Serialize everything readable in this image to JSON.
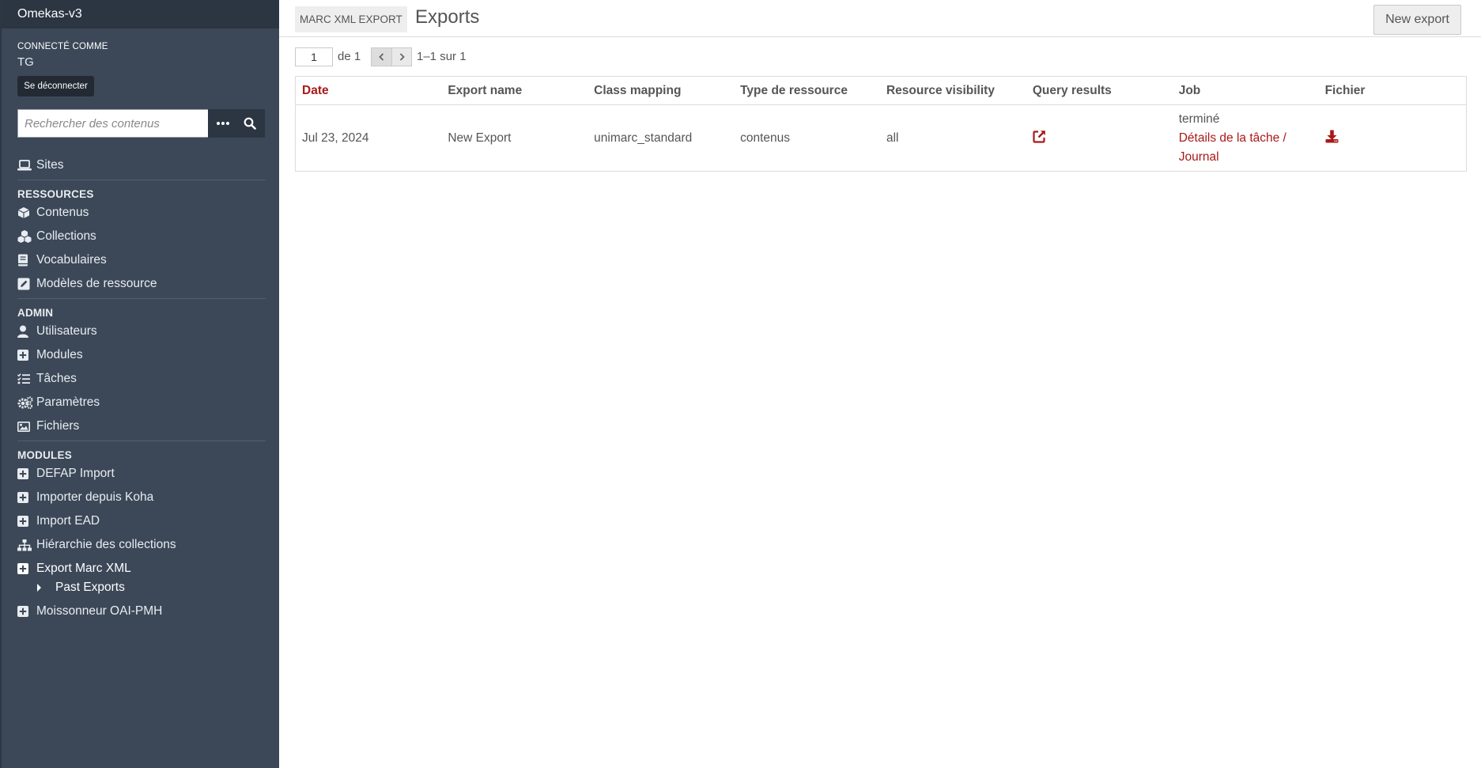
{
  "app": {
    "title": "Omekas-v3"
  },
  "user": {
    "logged_in_label": "CONNECTÉ COMME",
    "name": "TG",
    "logout_label": "Se déconnecter"
  },
  "search": {
    "placeholder": "Rechercher des contenus"
  },
  "nav": {
    "sites": {
      "label": "Sites",
      "icon": "laptop-icon"
    },
    "resources_title": "RESSOURCES",
    "resources": [
      {
        "label": "Contenus",
        "icon": "cube-icon"
      },
      {
        "label": "Collections",
        "icon": "cubes-icon"
      },
      {
        "label": "Vocabulaires",
        "icon": "book-icon"
      },
      {
        "label": "Modèles de ressource",
        "icon": "edit-square-icon"
      }
    ],
    "admin_title": "ADMIN",
    "admin": [
      {
        "label": "Utilisateurs",
        "icon": "user-icon"
      },
      {
        "label": "Modules",
        "icon": "plus-square-icon"
      },
      {
        "label": "Tâches",
        "icon": "tasks-icon"
      },
      {
        "label": "Paramètres",
        "icon": "cogs-icon"
      },
      {
        "label": "Fichiers",
        "icon": "image-icon"
      }
    ],
    "modules_title": "MODULES",
    "modules": [
      {
        "label": "DEFAP Import",
        "icon": "plus-square-icon"
      },
      {
        "label": "Importer depuis Koha",
        "icon": "plus-square-icon"
      },
      {
        "label": "Import EAD",
        "icon": "plus-square-icon"
      },
      {
        "label": "Hiérarchie des collections",
        "icon": "sitemap-icon"
      },
      {
        "label": "Export Marc XML",
        "icon": "plus-square-icon"
      },
      {
        "label": "Past Exports",
        "icon": "caret-right-icon"
      },
      {
        "label": "Moissonneur OAI-PMH",
        "icon": "plus-square-icon"
      }
    ]
  },
  "header": {
    "module_badge": "MARC XML EXPORT",
    "title": "Exports",
    "new_export_label": "New export"
  },
  "pagination": {
    "current_page": "1",
    "of_label": "de 1",
    "range_label": "1–1 sur 1"
  },
  "table": {
    "columns": [
      "Date",
      "Export name",
      "Class mapping",
      "Type de ressource",
      "Resource visibility",
      "Query results",
      "Job",
      "Fichier"
    ],
    "rows": [
      {
        "date": "Jul 23, 2024",
        "export_name": "New Export",
        "class_mapping": "unimarc_standard",
        "resource_type": "contenus",
        "visibility": "all",
        "query_icon": "external-link-icon",
        "job_status": "terminé",
        "job_details": "Détails de la tâche",
        "job_separator": " / ",
        "job_log": "Journal",
        "file_icon": "download-icon"
      }
    ]
  },
  "colors": {
    "sidebar_bg": "#3c4858",
    "sidebar_top": "#2c3542",
    "accent_red": "#a91919"
  }
}
